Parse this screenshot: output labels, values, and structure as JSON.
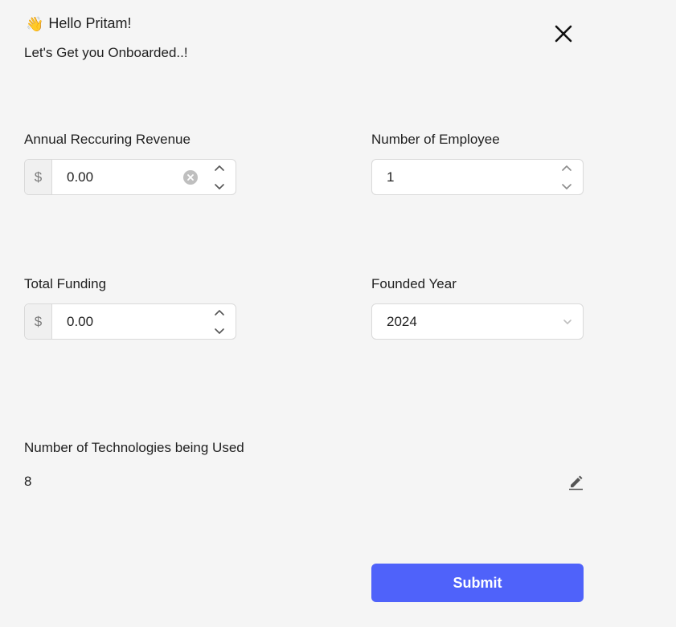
{
  "header": {
    "wave_icon": "👋",
    "greeting": "Hello Pritam!",
    "subtitle": "Let's Get you Onboarded..!"
  },
  "icons": {
    "close": "close-icon",
    "clear": "clear-icon",
    "edit": "pencil-icon",
    "stepper": "stepper-up-down-icon",
    "dropdown": "chevron-down-icon"
  },
  "fields": {
    "arr": {
      "label": "Annual Reccuring Revenue",
      "prefix": "$",
      "value": "0.00"
    },
    "employees": {
      "label": "Number of Employee",
      "value": "1"
    },
    "funding": {
      "label": "Total Funding",
      "prefix": "$",
      "value": "0.00"
    },
    "founded": {
      "label": "Founded Year",
      "value": "2024"
    },
    "technologies": {
      "label": "Number of Technologies being Used",
      "value": "8"
    }
  },
  "actions": {
    "submit_label": "Submit"
  },
  "colors": {
    "background": "#f5f5f5",
    "primary": "#4f62fa",
    "border": "#d9d9d9"
  }
}
